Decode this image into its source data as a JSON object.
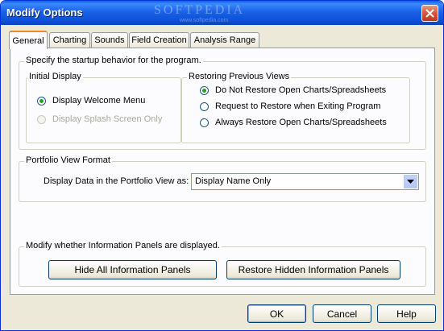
{
  "window": {
    "title": "Modify Options",
    "watermark": "SOFTPEDIA",
    "watermark_sub": "www.softpedia.com"
  },
  "tabs": [
    {
      "label": "General",
      "active": true
    },
    {
      "label": "Charting",
      "active": false
    },
    {
      "label": "Sounds",
      "active": false
    },
    {
      "label": "Field Creation",
      "active": false
    },
    {
      "label": "Analysis Range",
      "active": false
    }
  ],
  "startup": {
    "label": "Specify the startup behavior for the program.",
    "initial_display": {
      "label": "Initial Display",
      "options": [
        {
          "label": "Display Welcome Menu",
          "checked": true,
          "disabled": false
        },
        {
          "label": "Display Splash Screen Only",
          "checked": false,
          "disabled": true
        }
      ]
    },
    "restoring": {
      "label": "Restoring Previous Views",
      "options": [
        {
          "label": "Do Not Restore Open Charts/Spreadsheets",
          "checked": true
        },
        {
          "label": "Request to Restore when Exiting Program",
          "checked": false
        },
        {
          "label": "Always Restore Open Charts/Spreadsheets",
          "checked": false
        }
      ]
    }
  },
  "portfolio": {
    "label": "Portfolio View Format",
    "field_label": "Display Data in the Portfolio View as:",
    "selected": "Display Name Only"
  },
  "info_panels": {
    "label": "Modify whether Information Panels are displayed.",
    "hide_button": "Hide All Information Panels",
    "restore_button": "Restore Hidden Information Panels"
  },
  "footer": {
    "ok": "OK",
    "cancel": "Cancel",
    "help": "Help"
  },
  "colors": {
    "titlebar": "#0a5fe3",
    "dialog_bg": "#ece9d8",
    "tab_accent": "#e68b2c",
    "radio_dot": "#21a121"
  }
}
